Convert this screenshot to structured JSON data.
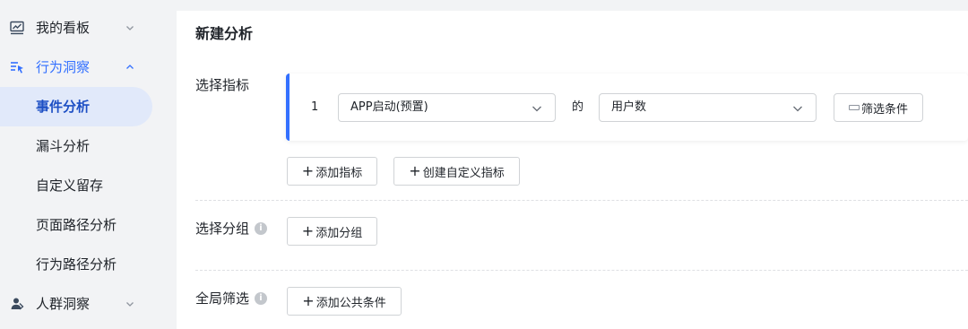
{
  "sidebar": {
    "items": [
      {
        "label": "我的看板",
        "icon": "dashboard-chart-icon"
      },
      {
        "label": "行为洞察",
        "icon": "behavior-insight-icon"
      },
      {
        "label": "人群洞察",
        "icon": "people-icon"
      }
    ],
    "sub_items": [
      {
        "label": "事件分析"
      },
      {
        "label": "漏斗分析"
      },
      {
        "label": "自定义留存"
      },
      {
        "label": "页面路径分析"
      },
      {
        "label": "行为路径分析"
      }
    ],
    "active_sub_item": "事件分析"
  },
  "main": {
    "title": "新建分析",
    "metrics_section": {
      "label": "选择指标",
      "metric_index": "1",
      "event_select_value": "APP启动(预置)",
      "connector": "的",
      "measure_select_value": "用户数",
      "filter_button": "筛选条件",
      "add_metric_button": "添加指标",
      "create_custom_metric_button": "创建自定义指标"
    },
    "group_section": {
      "label": "选择分组",
      "add_group_button": "添加分组"
    },
    "filter_section": {
      "label": "全局筛选",
      "add_common_condition_button": "添加公共条件"
    }
  },
  "colors": {
    "accent": "#3370ff",
    "active_bg": "#e1e9fa",
    "sidebar_bg": "#f2f3f5"
  }
}
